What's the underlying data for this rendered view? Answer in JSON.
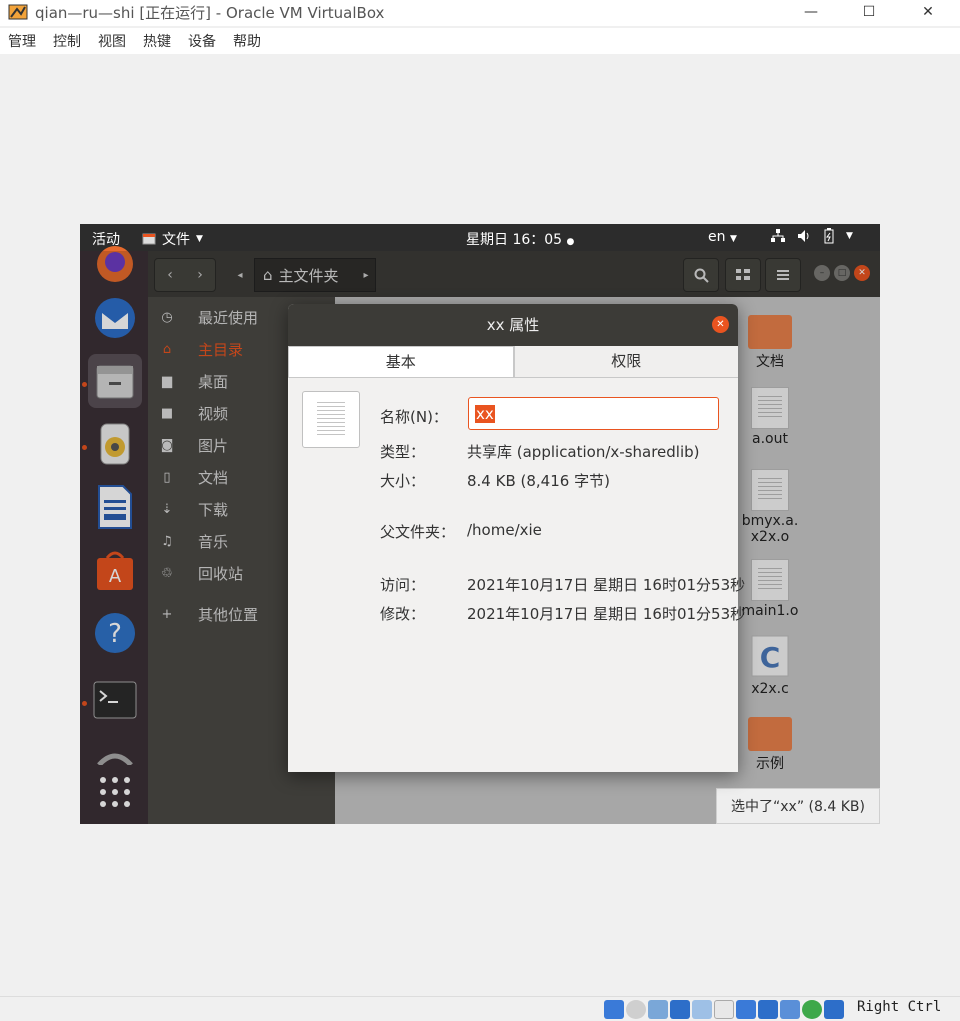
{
  "host": {
    "title": "qian—ru—shi [正在运行] - Oracle VM VirtualBox",
    "menu": [
      "管理",
      "控制",
      "视图",
      "热键",
      "设备",
      "帮助"
    ],
    "win_controls": {
      "minimize": "—",
      "maximize": "☐",
      "close": "✕"
    },
    "host_key": "Right Ctrl"
  },
  "guest": {
    "topbar": {
      "activities": "活动",
      "app_menu": "文件",
      "clock": "星期日 16：05",
      "lang": "en"
    },
    "nautilus": {
      "path_home": "主文件夹",
      "sidebar": [
        {
          "icon": "recent-icon",
          "label": "最近使用"
        },
        {
          "icon": "home-icon",
          "label": "主目录"
        },
        {
          "icon": "desktop-icon",
          "label": "桌面"
        },
        {
          "icon": "video-icon",
          "label": "视频"
        },
        {
          "icon": "camera-icon",
          "label": "图片"
        },
        {
          "icon": "document-icon",
          "label": "文档"
        },
        {
          "icon": "download-icon",
          "label": "下载"
        },
        {
          "icon": "music-icon",
          "label": "音乐"
        },
        {
          "icon": "trash-icon",
          "label": "回收站"
        },
        {
          "icon": "plus-icon",
          "label": "其他位置"
        }
      ],
      "files": [
        "文档",
        "a.out",
        "bmyx.a.",
        "x2x.o",
        "main1.o",
        "x2x.c",
        "示例"
      ],
      "status": "选中了“xx” (8.4 KB)"
    },
    "dialog": {
      "title": "xx 属性",
      "tabs": [
        "基本",
        "权限"
      ],
      "name_label": "名称(N)：",
      "name_value": "xx",
      "type_label": "类型：",
      "type_value": "共享库 (application/x-sharedlib)",
      "size_label": "大小：",
      "size_value": "8.4 KB (8,416 字节)",
      "parent_label": "父文件夹：",
      "parent_value": "/home/xie",
      "access_label": "访问：",
      "access_value": "2021年10月17日 星期日 16时01分53秒",
      "modified_label": "修改：",
      "modified_value": "2021年10月17日 星期日 16时01分53秒"
    }
  },
  "colors": {
    "accent": "#e95420",
    "dock": "#3b3036",
    "headerbar": "#3c3b37"
  }
}
